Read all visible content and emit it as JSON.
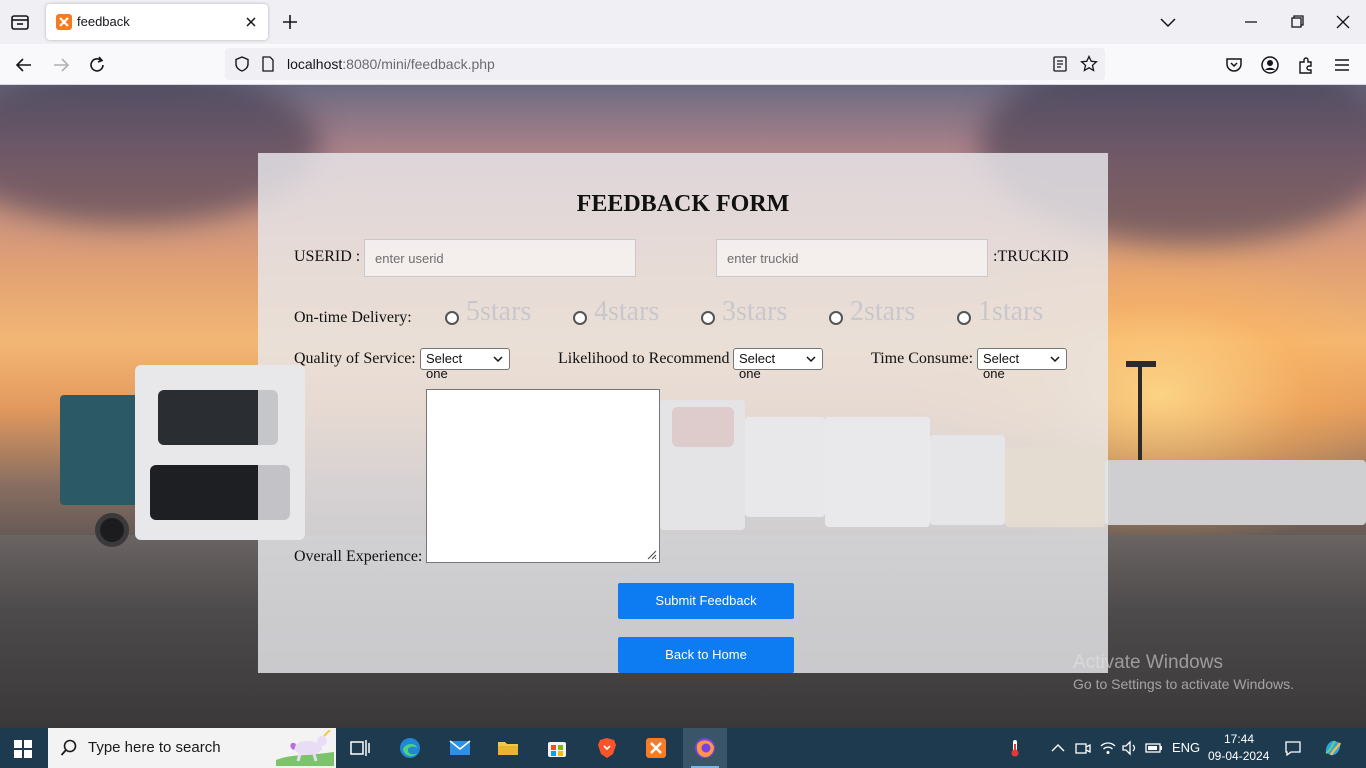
{
  "browser": {
    "tab_title": "feedback",
    "url_host": "localhost",
    "url_rest": ":8080/mini/feedback.php"
  },
  "form": {
    "title": "FEEDBACK FORM",
    "userid_label": "USERID :",
    "userid_placeholder": "enter userid",
    "truckid_placeholder": "enter truckid",
    "truckid_label": ":TRUCKID",
    "ontime_label": "On-time Delivery:",
    "ratings": [
      "5stars",
      "4stars",
      "3stars",
      "2stars",
      "1stars"
    ],
    "quality_label": "Quality of Service:",
    "quality_value": "Select one",
    "recommend_label": "Likelihood to Recommend",
    "recommend_value": "Select one",
    "time_label": "Time Consume:",
    "time_value": "Select one",
    "overall_label": "Overall Experience:",
    "submit_label": "Submit Feedback",
    "home_label": "Back to Home"
  },
  "watermark": {
    "line1": "Activate Windows",
    "line2": "Go to Settings to activate Windows."
  },
  "taskbar": {
    "search_placeholder": "Type here to search",
    "language": "ENG",
    "time": "17:44",
    "date": "09-04-2024"
  },
  "colors": {
    "accent_button": "#0d7cf2",
    "taskbar": "#1d3a4f"
  }
}
